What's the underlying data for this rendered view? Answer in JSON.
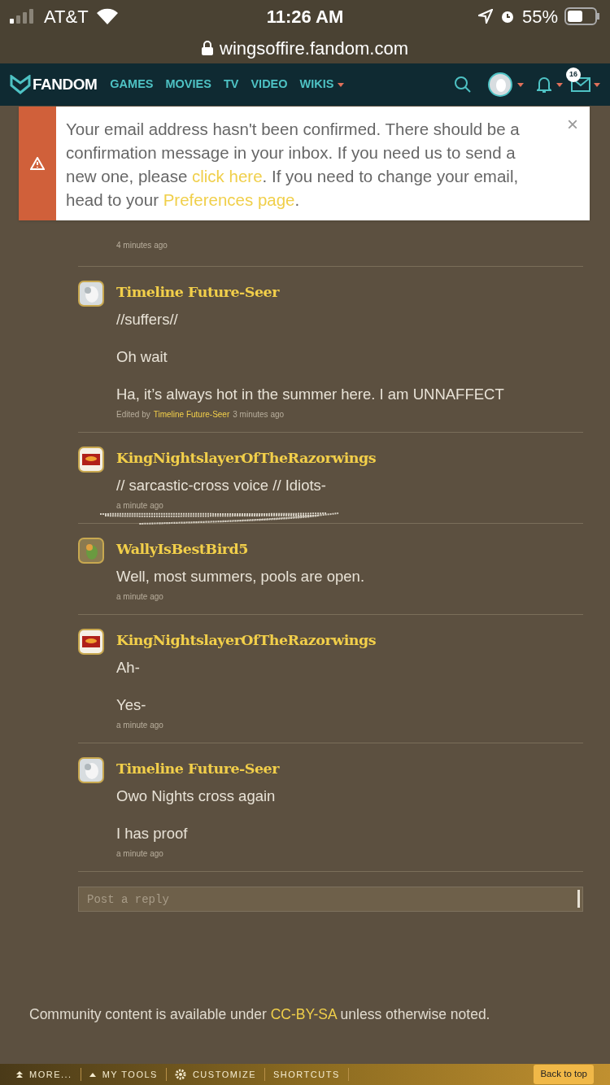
{
  "status_bar": {
    "carrier": "AT&T",
    "time": "11:26 AM",
    "battery": "55%"
  },
  "url_bar": {
    "url": "wingsoffire.fandom.com"
  },
  "nav": {
    "logo": "FANDOM",
    "items": [
      {
        "label": "GAMES",
        "dropdown": false
      },
      {
        "label": "MOVIES",
        "dropdown": false
      },
      {
        "label": "TV",
        "dropdown": false
      },
      {
        "label": "VIDEO",
        "dropdown": false
      },
      {
        "label": "WIKIS",
        "dropdown": true
      }
    ],
    "message_count": "16"
  },
  "banner": {
    "parts": [
      {
        "kind": "text",
        "text": "Your email address hasn't been confirmed. There should be a confirmation message in your inbox. If you need us to send a new one, please "
      },
      {
        "kind": "link",
        "text": "click here"
      },
      {
        "kind": "text",
        "text": ". If you need to change your email, head to your "
      },
      {
        "kind": "link",
        "text": "Preferences page"
      },
      {
        "kind": "text",
        "text": "."
      }
    ],
    "close": "×"
  },
  "first_time": "4 minutes ago",
  "comments": [
    {
      "author": "Timeline Future-Seer",
      "paragraphs": [
        "//suffers//",
        "Oh wait",
        "Ha, it’s always hot in the summer here. I am UNNAFFECT"
      ],
      "edited_by": "Timeline Future-Seer",
      "edited_prefix": "Edited by",
      "time": "3 minutes ago"
    },
    {
      "author": "KingNightslayerOfTheRazorwings",
      "paragraphs": [
        "// sarcastic-cross voice // Idiots-"
      ],
      "time": "a minute ago"
    },
    {
      "author": "WallyIsBestBird5",
      "paragraphs": [
        "Well, most summers, pools are open."
      ],
      "time": "a minute ago"
    },
    {
      "author": "KingNightslayerOfTheRazorwings",
      "paragraphs": [
        "Ah-",
        "Yes-"
      ],
      "time": "a minute ago"
    },
    {
      "author": "Timeline Future-Seer",
      "paragraphs": [
        "Owo Nights cross again",
        "I has proof"
      ],
      "time": "a minute ago"
    }
  ],
  "reply": {
    "placeholder": "Post a reply"
  },
  "footer": {
    "before": "Community content is available under ",
    "link": "CC-BY-SA",
    "after": " unless otherwise noted."
  },
  "toolbar": {
    "items": [
      {
        "label": "MORE..."
      },
      {
        "label": "MY TOOLS"
      },
      {
        "label": "CUSTOMIZE"
      },
      {
        "label": "SHORTCUTS"
      }
    ],
    "back": "Back to top"
  }
}
